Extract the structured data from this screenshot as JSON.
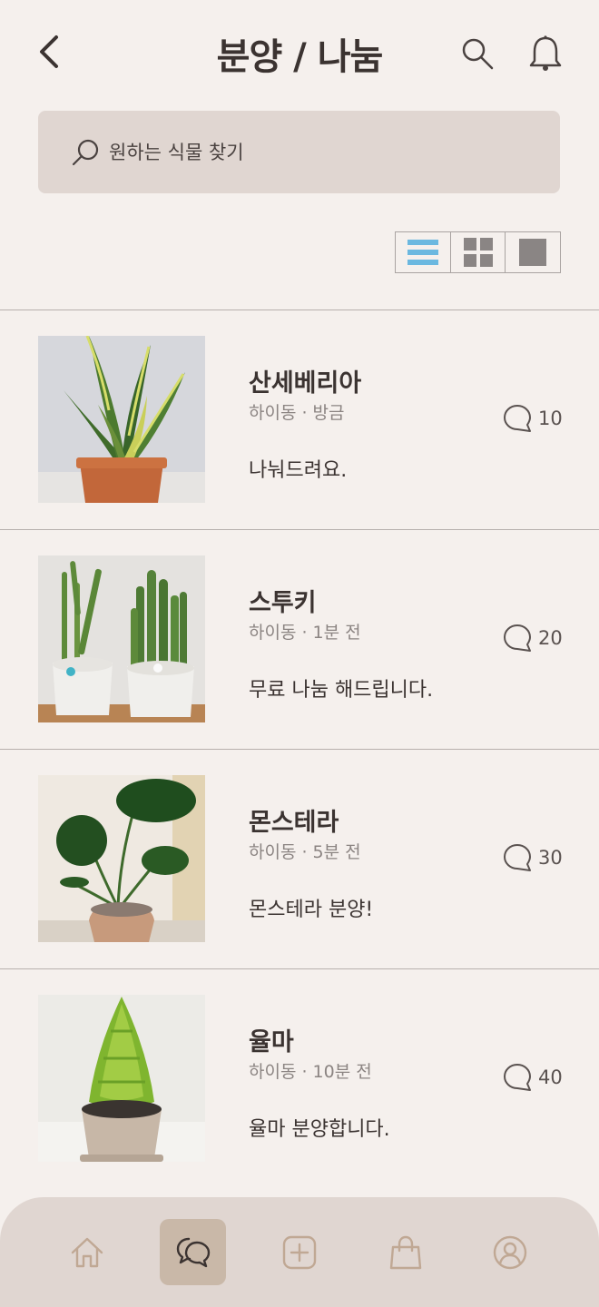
{
  "header": {
    "title": "분양 / 나눔",
    "back_icon": "chevron-left-icon",
    "search_icon": "search-icon",
    "bell_icon": "bell-icon"
  },
  "search": {
    "placeholder": "원하는 식물 찾기",
    "icon": "search-icon"
  },
  "view_modes": [
    {
      "icon": "list-view-icon",
      "active": true
    },
    {
      "icon": "grid-view-icon",
      "active": false
    },
    {
      "icon": "single-view-icon",
      "active": false
    }
  ],
  "posts": [
    {
      "name": "산세베리아",
      "location": "하이동",
      "time": "방금",
      "meta": "하이동 · 방금",
      "description": "나눠드려요.",
      "comments": "10",
      "image": "sansevieria-photo"
    },
    {
      "name": "스투키",
      "location": "하이동",
      "time": "1분 전",
      "meta": "하이동 · 1분 전",
      "description": "무료 나눔 해드립니다.",
      "comments": "20",
      "image": "stuckyi-photo"
    },
    {
      "name": "몬스테라",
      "location": "하이동",
      "time": "5분 전",
      "meta": "하이동 · 5분 전",
      "description": "몬스테라 분양!",
      "comments": "30",
      "image": "monstera-photo"
    },
    {
      "name": "율마",
      "location": "하이동",
      "time": "10분 전",
      "meta": "하이동 · 10분 전",
      "description": "율마 분양합니다.",
      "comments": "40",
      "image": "goldcrest-photo"
    }
  ],
  "bottom_nav": [
    {
      "icon": "home-icon",
      "active": false
    },
    {
      "icon": "chat-icon",
      "active": true
    },
    {
      "icon": "add-icon",
      "active": false
    },
    {
      "icon": "shopping-bag-icon",
      "active": false
    },
    {
      "icon": "profile-icon",
      "active": false
    }
  ],
  "colors": {
    "background": "#f5f0ed",
    "search_bg": "#e0d6d1",
    "nav_bg": "#e0d6d1",
    "nav_active_bg": "#c9b8a8",
    "accent_blue": "#6bb8e0",
    "text_primary": "#3b3331",
    "text_secondary": "#8b8482"
  }
}
